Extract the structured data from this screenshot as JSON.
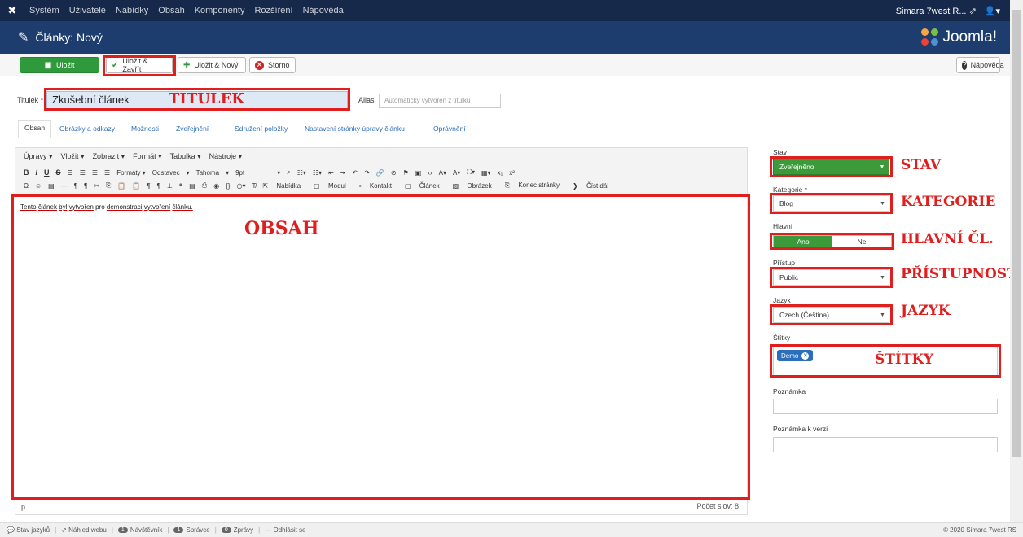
{
  "navbar": {
    "items": [
      "Systém",
      "Uživatelé",
      "Nabídky",
      "Obsah",
      "Komponenty",
      "Rozšíření",
      "Nápověda"
    ],
    "user": "Simara 7west R..."
  },
  "header": {
    "title": "Články: Nový",
    "brand": "Joomla!"
  },
  "toolbar": {
    "save": "Uložit",
    "save_close": "Uložit & Zavřít",
    "save_new": "Uložit & Nový",
    "cancel": "Storno",
    "help": "Nápověda"
  },
  "form": {
    "title_label": "Titulek *",
    "title_value": "Zkušební článek",
    "alias_label": "Alias",
    "alias_placeholder": "Automaticky vytvořen z titulku"
  },
  "tabs": [
    "Obsah",
    "Obrázky a odkazy",
    "Možnosti",
    "Zveřejnění",
    "Sdružení položky",
    "Nastavení stránky úpravy článku",
    "Oprávnění"
  ],
  "editor": {
    "menus": [
      "Úpravy ▾",
      "Vložit ▾",
      "Zobrazit ▾",
      "Formát ▾",
      "Tabulka ▾",
      "Nástroje ▾"
    ],
    "formats": "Formáty ▾",
    "paragraph": "Odstavec",
    "font": "Tahoma",
    "size": "9pt",
    "buttons": [
      "Nabídka",
      "Modul",
      "Kontakt",
      "Článek",
      "Obrázek",
      "Konec stránky",
      "Číst dál"
    ],
    "content_words": [
      "Tento",
      "článek",
      "byl",
      "vytvořen",
      "pro",
      "demonstraci",
      "vytvoření",
      "článku."
    ],
    "path": "p",
    "word_count": "Počet slov: 8"
  },
  "sidebar": {
    "state_label": "Stav",
    "state_value": "Zveřejněno",
    "category_label": "Kategorie *",
    "category_value": "Blog",
    "featured_label": "Hlavní",
    "featured_yes": "Ano",
    "featured_no": "Ne",
    "access_label": "Přístup",
    "access_value": "Public",
    "language_label": "Jazyk",
    "language_value": "Czech (Čeština)",
    "tags_label": "Štítky",
    "tag_value": "Demo",
    "note_label": "Poznámka",
    "version_note_label": "Poznámka k verzi"
  },
  "annotations": {
    "title": "TITULEK",
    "content": "OBSAH",
    "state": "STAV",
    "category": "KATEGORIE",
    "featured": "HLAVNÍ ČL.",
    "access": "PŘÍSTUPNOST",
    "language": "JAZYK",
    "tags": "ŠTÍTKY"
  },
  "footer": {
    "language_status": "Stav jazyků",
    "preview": "Náhled webu",
    "visitors_count": "1",
    "visitors": "Návštěvník",
    "admins_count": "1",
    "admins": "Správce",
    "messages_count": "0",
    "messages": "Zprávy",
    "logout": "Odhlásit se",
    "copyright": "© 2020 Simara 7west RS"
  },
  "colors": {
    "navbar": "#17294a",
    "header": "#1c3d6e",
    "primary": "#2f9a3b",
    "annotation": "#e01e1e",
    "link": "#2a6ebc"
  }
}
